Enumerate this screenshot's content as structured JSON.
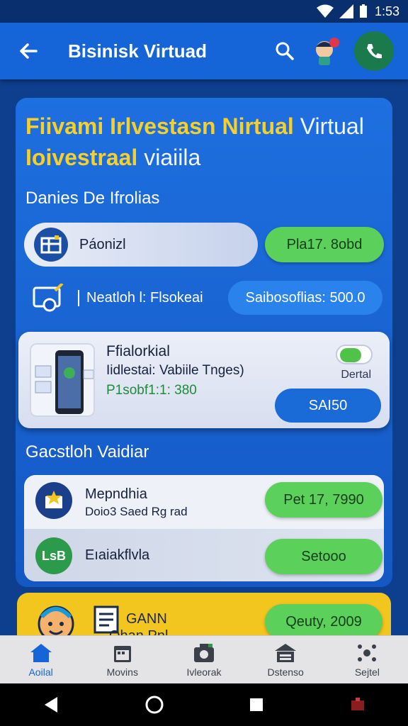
{
  "status": {
    "time": "1:53"
  },
  "app_bar": {
    "title": "Bisinisk Virtuad"
  },
  "hero": {
    "line1_yellow": "Fiivami Irlvestasn Nirtual",
    "line1_white": "Virtual",
    "line2_yellow": "Ioivestraal",
    "line2_white": "viaiila"
  },
  "section1": {
    "label": "Danies De Ifrolias"
  },
  "row1": {
    "label": "Páonizl",
    "button": "Pla17. 8obd"
  },
  "row2": {
    "label": "Neatloh l: Flsokeai",
    "button": "Saibosoflias: 500.0"
  },
  "product": {
    "name": "Ffialorkial",
    "desc": "Iidlestai: Vabiile Tnges)",
    "price": "P1sobf1:1: 380",
    "toggle_label": "Dertal",
    "button": "SAI50"
  },
  "section2": {
    "label": "Gacstloh Vaidiar"
  },
  "list": [
    {
      "title": "Mepndhia",
      "subtitle": "Doio3 Saed Rg rad",
      "button": "Pet 17, 7990",
      "icon_text": "★"
    },
    {
      "title": "Eıaiakflvla",
      "subtitle": "",
      "button": "Setooo",
      "icon_text": "LsB"
    }
  ],
  "promo": {
    "line1": "GANN",
    "line2": "Qhan Pnl.",
    "button": "Qeuty, 2009"
  },
  "bottom_nav": [
    {
      "label": "Aoilal",
      "icon": "home-icon",
      "active": true
    },
    {
      "label": "Movins",
      "icon": "calendar-icon",
      "active": false
    },
    {
      "label": "Ivleorak",
      "icon": "camera-icon",
      "active": false
    },
    {
      "label": "Dstenso",
      "icon": "store-icon",
      "active": false
    },
    {
      "label": "Sejtel",
      "icon": "network-icon",
      "active": false
    }
  ],
  "colors": {
    "primary": "#1565d8",
    "accent_green": "#5bd05a",
    "accent_yellow": "#f3c51f"
  }
}
